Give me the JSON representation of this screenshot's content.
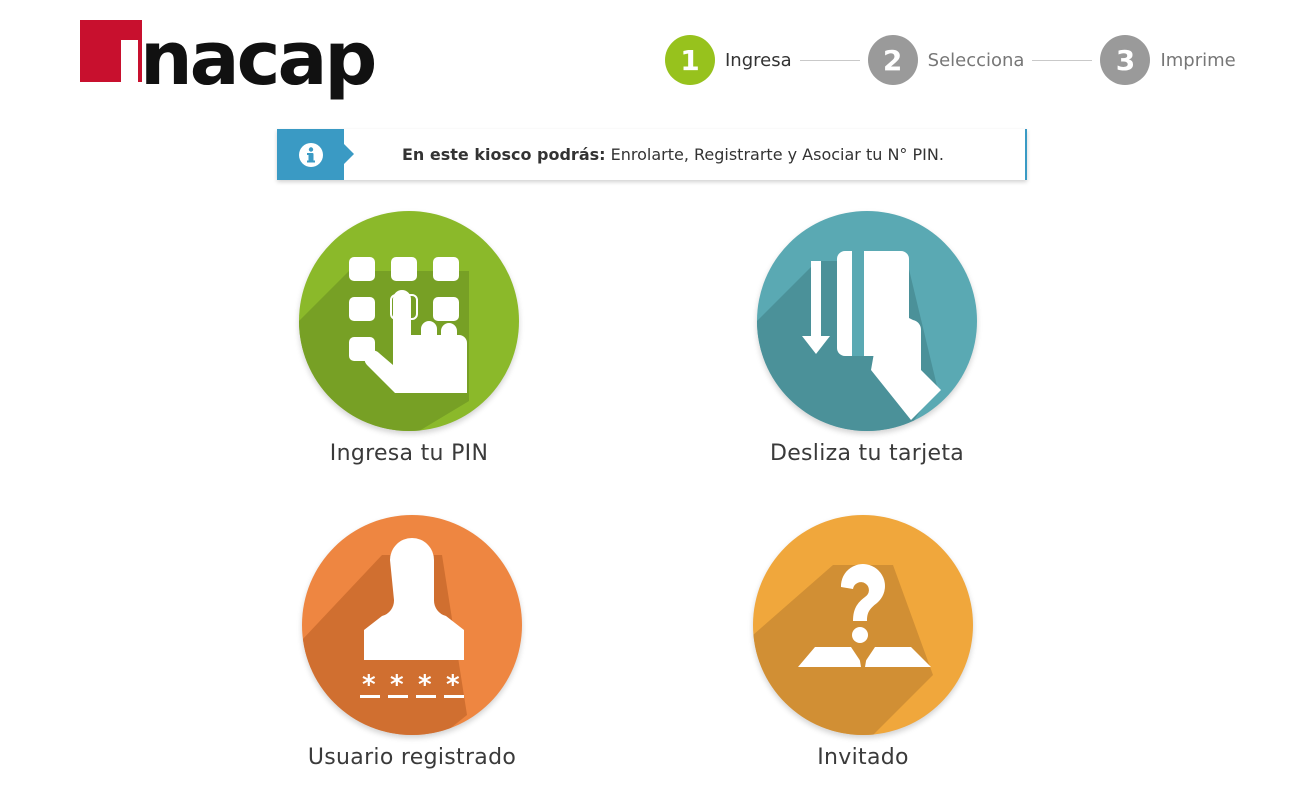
{
  "brand": {
    "logo_text": "nacap",
    "color": "#c8102e"
  },
  "steps": [
    {
      "number": "1",
      "label": "Ingresa",
      "state": "active"
    },
    {
      "number": "2",
      "label": "Selecciona",
      "state": "inactive"
    },
    {
      "number": "3",
      "label": "Imprime",
      "state": "inactive"
    }
  ],
  "info": {
    "icon": "info-icon",
    "bold": "En este kiosco podrás:",
    "text": " Enrolarte, Registrarte y Asociar tu N° PIN."
  },
  "options": [
    {
      "label": "Ingresa tu PIN",
      "icon": "keypad-icon",
      "color": "#8bb92a"
    },
    {
      "label": "Desliza tu tarjeta",
      "icon": "swipe-card-icon",
      "color": "#5aa9b3"
    },
    {
      "label": "Usuario registrado",
      "icon": "registered-user-icon",
      "color": "#ee8641"
    },
    {
      "label": "Invitado",
      "icon": "guest-icon",
      "color": "#f0a73c"
    }
  ]
}
